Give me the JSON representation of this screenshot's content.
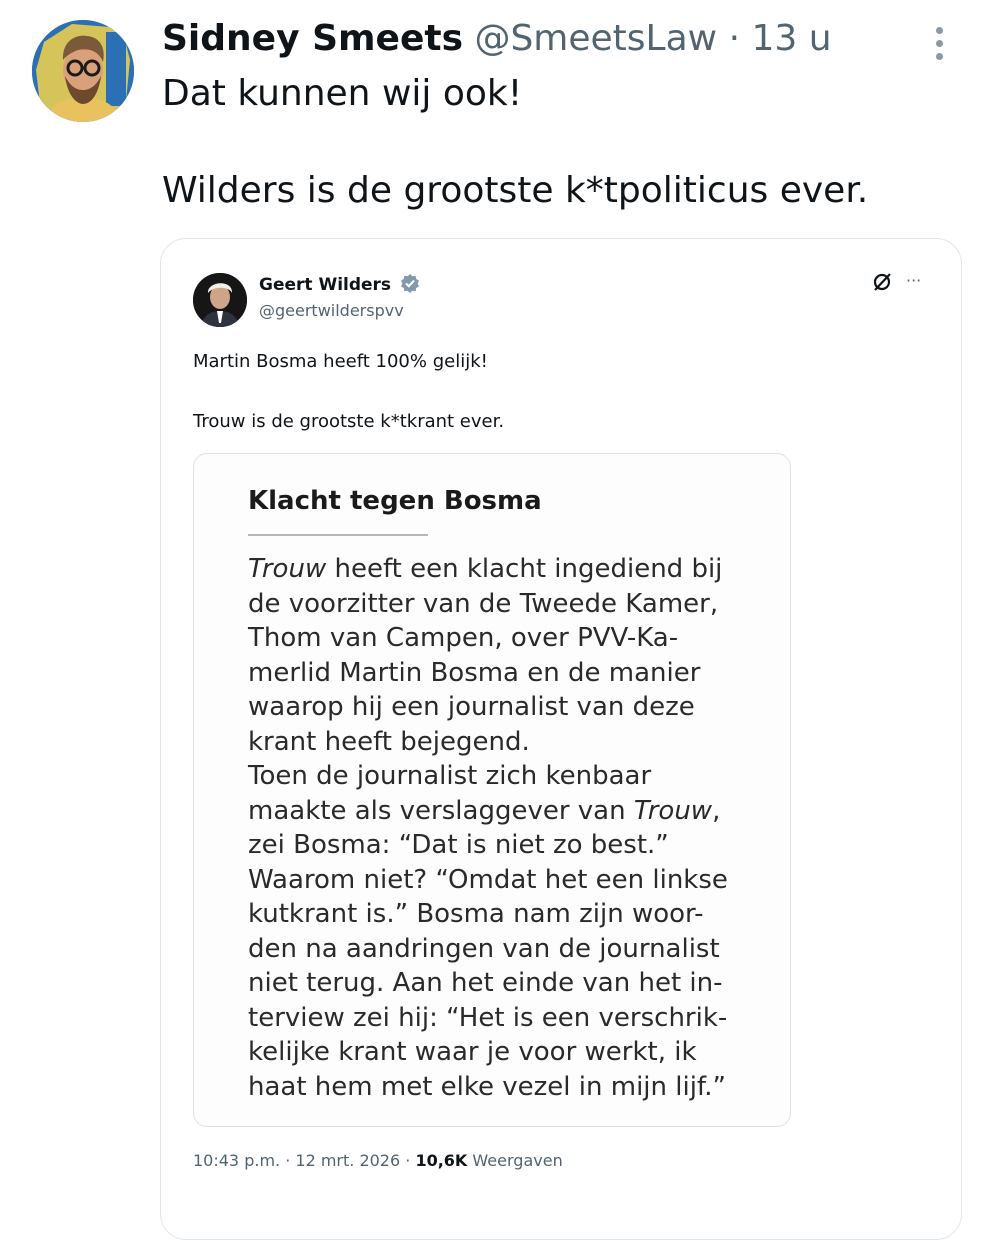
{
  "tweet": {
    "author_name": "Sidney Smeets",
    "author_handle": "@SmeetsLaw",
    "separator": "·",
    "time": "13 u",
    "text_lines": [
      "Dat kunnen wij ook!",
      "Wilders is de grootste k*tpoliticus ever."
    ]
  },
  "quote": {
    "author_name": "Geert Wilders",
    "author_handle": "@geertwilderspvv",
    "text_lines": [
      "Martin Bosma heeft 100% gelijk!",
      "Trouw is de grootste k*tkrant ever."
    ],
    "article": {
      "title": "Klacht tegen Bosma",
      "body_lines": [
        "Trouw heeft een klacht ingediend bij",
        "de voorzitter van de Tweede Kamer,",
        "Thom van Campen, over PVV-Ka-",
        "merlid Martin Bosma en de manier",
        "waarop hij een journalist van deze",
        "krant heeft bejegend.",
        "Toen de journalist zich kenbaar",
        "maakte als verslaggever van Trouw,",
        "zei Bosma: “Dat is niet zo best.”",
        "Waarom niet? “Omdat het een linkse",
        "kutkrant is.” Bosma nam zijn woor-",
        "den na aandringen van de journalist",
        "niet terug. Aan het einde van het in-",
        "terview zei hij: “Het is een verschrik-",
        "kelijke krant waar je voor werkt, ik",
        "haat hem met elke vezel in mijn lijf.”"
      ]
    },
    "footer": {
      "time": "10:43 p.m.",
      "date": "12 mrt. 2026",
      "views_count": "10,6K",
      "views_label": "Weergaven"
    }
  },
  "icons": {
    "more_menu": "vertical-more-icon",
    "verified": "verified-badge-icon",
    "grok": "slashed-circle-icon",
    "quote_more": "horizontal-more-icon"
  },
  "colors": {
    "text_primary": "#0f1419",
    "text_secondary": "#536471",
    "border": "#e3e6e9",
    "verified_badge": "#829aab"
  }
}
